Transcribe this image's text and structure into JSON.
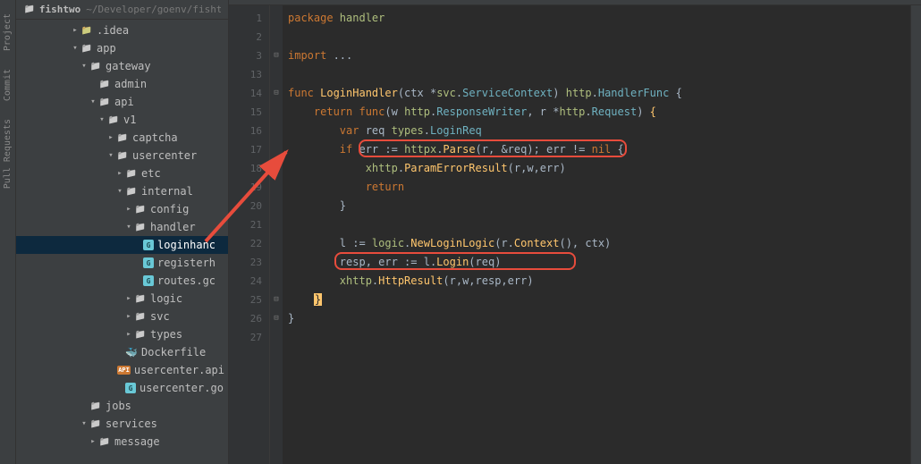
{
  "left_rail": {
    "items": [
      "Project",
      "Commit",
      "Pull Requests"
    ]
  },
  "sidebar": {
    "project_name": "fishtwo",
    "project_path": "~/Developer/goenv/fisht",
    "nodes": [
      {
        "indent": 6,
        "arrow": ">",
        "icon": "folder-brown",
        "label": ".idea"
      },
      {
        "indent": 6,
        "arrow": "v",
        "icon": "folder",
        "label": "app"
      },
      {
        "indent": 7,
        "arrow": "v",
        "icon": "folder",
        "label": "gateway"
      },
      {
        "indent": 8,
        "arrow": "",
        "icon": "folder",
        "label": "admin"
      },
      {
        "indent": 8,
        "arrow": "v",
        "icon": "folder",
        "label": "api"
      },
      {
        "indent": 9,
        "arrow": "v",
        "icon": "folder",
        "label": "v1"
      },
      {
        "indent": 10,
        "arrow": ">",
        "icon": "folder",
        "label": "captcha"
      },
      {
        "indent": 10,
        "arrow": "v",
        "icon": "folder",
        "label": "usercenter"
      },
      {
        "indent": 11,
        "arrow": ">",
        "icon": "folder",
        "label": "etc"
      },
      {
        "indent": 11,
        "arrow": "v",
        "icon": "folder",
        "label": "internal"
      },
      {
        "indent": 12,
        "arrow": ">",
        "icon": "folder",
        "label": "config"
      },
      {
        "indent": 12,
        "arrow": "v",
        "icon": "folder",
        "label": "handler"
      },
      {
        "indent": 13,
        "arrow": "",
        "icon": "go",
        "label": "loginhanc",
        "selected": true
      },
      {
        "indent": 13,
        "arrow": "",
        "icon": "go",
        "label": "registerh"
      },
      {
        "indent": 13,
        "arrow": "",
        "icon": "go",
        "label": "routes.gc"
      },
      {
        "indent": 12,
        "arrow": ">",
        "icon": "folder",
        "label": "logic"
      },
      {
        "indent": 12,
        "arrow": ">",
        "icon": "folder",
        "label": "svc"
      },
      {
        "indent": 12,
        "arrow": ">",
        "icon": "folder",
        "label": "types"
      },
      {
        "indent": 11,
        "arrow": "",
        "icon": "docker",
        "label": "Dockerfile"
      },
      {
        "indent": 11,
        "arrow": "",
        "icon": "api",
        "label": "usercenter.api"
      },
      {
        "indent": 11,
        "arrow": "",
        "icon": "go",
        "label": "usercenter.go"
      },
      {
        "indent": 7,
        "arrow": "",
        "icon": "folder",
        "label": "jobs"
      },
      {
        "indent": 7,
        "arrow": "v",
        "icon": "folder",
        "label": "services"
      },
      {
        "indent": 8,
        "arrow": ">",
        "icon": "folder",
        "label": "message"
      }
    ]
  },
  "editor": {
    "gutter_lines": [
      "1",
      "2",
      "3",
      "13",
      "14",
      "15",
      "16",
      "17",
      "18",
      "19",
      "20",
      "21",
      "22",
      "23",
      "24",
      "25",
      "26",
      "27"
    ],
    "fold_marks": [
      "",
      "",
      "⊟",
      "",
      "⊟",
      "",
      "",
      "",
      "",
      "",
      "",
      "",
      "",
      "",
      "",
      "⊟",
      "⊟",
      ""
    ],
    "code": {
      "l0": "package ",
      "l0p": "handler",
      "l2": "import ",
      "l2e": "...",
      "l4a": "func ",
      "l4b": "LoginHandler",
      "l4c": "(ctx *",
      "l4d": "svc",
      "l4e": ".",
      "l4f": "ServiceContext",
      "l4g": ") ",
      "l4h": "http",
      "l4i": ".",
      "l4j": "HandlerFunc",
      "l4k": " {",
      "l5a": "    return func",
      "l5b": "(w ",
      "l5c": "http",
      "l5d": ".",
      "l5e": "ResponseWriter",
      "l5f": ", r *",
      "l5g": "http",
      "l5h": ".",
      "l5i": "Request",
      "l5j": ") ",
      "l5k": "{",
      "l6a": "        var ",
      "l6b": "req ",
      "l6c": "types",
      "l6d": ".",
      "l6e": "LoginReq",
      "l7a": "        if ",
      "l7b": "err := ",
      "l7c": "httpx",
      "l7d": ".",
      "l7e": "Parse",
      "l7f": "(r, &req); err != ",
      "l7g": "nil",
      "l7h": " {",
      "l8a": "            ",
      "l8b": "xhttp",
      "l8c": ".",
      "l8d": "ParamErrorResult",
      "l8e": "(r,w,err)",
      "l9a": "            return",
      "l10a": "        }",
      "l12a": "        l := ",
      "l12b": "logic",
      "l12c": ".",
      "l12d": "NewLoginLogic",
      "l12e": "(r.",
      "l12f": "Context",
      "l12g": "(), ctx)",
      "l13a": "        resp, err := l.",
      "l13b": "Login",
      "l13c": "(req)",
      "l14a": "        ",
      "l14b": "xhttp",
      "l14c": ".",
      "l14d": "HttpResult",
      "l14e": "(r,w,resp,err)",
      "l15a": "    ",
      "l15b": "}",
      "l16a": "}"
    }
  }
}
